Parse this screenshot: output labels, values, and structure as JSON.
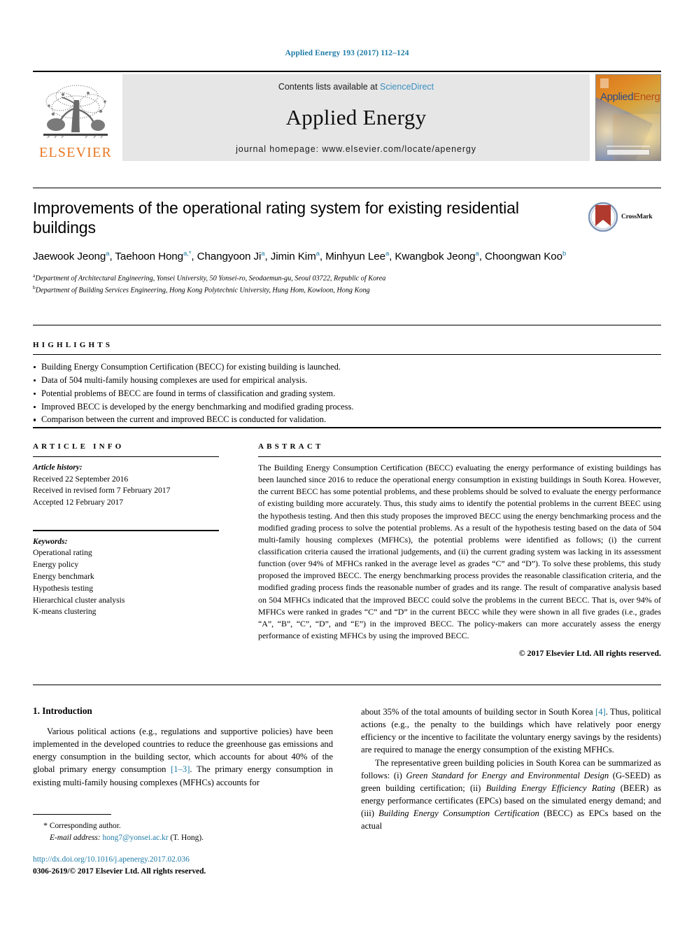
{
  "running_head": "Applied Energy 193 (2017) 112–124",
  "masthead": {
    "publisher_name": "ELSEVIER",
    "contents_prefix": "Contents lists available at ",
    "contents_link": "ScienceDirect",
    "journal_title": "Applied Energy",
    "homepage": "journal homepage: www.elsevier.com/locate/apenergy",
    "cover_title_a": "Applied",
    "cover_title_b": "Energy"
  },
  "article": {
    "title": "Improvements of the operational rating system for existing residential buildings",
    "crossmark_label": "CrossMark",
    "authors": [
      {
        "name": "Jaewook Jeong",
        "marks": "a",
        "sep": ", "
      },
      {
        "name": "Taehoon Hong",
        "marks": "a,*",
        "sep": ", "
      },
      {
        "name": "Changyoon Ji",
        "marks": "a",
        "sep": ", "
      },
      {
        "name": "Jimin Kim",
        "marks": "a",
        "sep": ", "
      },
      {
        "name": "Minhyun Lee",
        "marks": "a",
        "sep": ", "
      },
      {
        "name": "Kwangbok Jeong",
        "marks": "a",
        "sep": ", "
      },
      {
        "name": "Choongwan Koo",
        "marks": "b",
        "sep": ""
      }
    ],
    "affiliations": [
      {
        "mark": "a",
        "text": "Department of Architectural Engineering, Yonsei University, 50 Yonsei-ro, Seodaemun-gu, Seoul 03722, Republic of Korea"
      },
      {
        "mark": "b",
        "text": "Department of Building Services Engineering, Hong Kong Polytechnic University, Hung Hom, Kowloon, Hong Kong"
      }
    ]
  },
  "highlights": {
    "heading": "HIGHLIGHTS",
    "items": [
      "Building Energy Consumption Certification (BECC) for existing building is launched.",
      "Data of 504 multi-family housing complexes are used for empirical analysis.",
      "Potential problems of BECC are found in terms of classification and grading system.",
      "Improved BECC is developed by the energy benchmarking and modified grading process.",
      "Comparison between the current and improved BECC is conducted for validation."
    ]
  },
  "article_info": {
    "heading": "ARTICLE INFO",
    "history_label": "Article history:",
    "history": [
      "Received 22 September 2016",
      "Received in revised form 7 February 2017",
      "Accepted 12 February 2017"
    ],
    "keywords_label": "Keywords:",
    "keywords": [
      "Operational rating",
      "Energy policy",
      "Energy benchmark",
      "Hypothesis testing",
      "Hierarchical cluster analysis",
      "K-means clustering"
    ]
  },
  "abstract": {
    "heading": "ABSTRACT",
    "text": "The Building Energy Consumption Certification (BECC) evaluating the energy performance of existing buildings has been launched since 2016 to reduce the operational energy consumption in existing buildings in South Korea. However, the current BECC has some potential problems, and these problems should be solved to evaluate the energy performance of existing building more accurately. Thus, this study aims to identify the potential problems in the current BEEC using the hypothesis testing. And then this study proposes the improved BECC using the energy benchmarking process and the modified grading process to solve the potential problems. As a result of the hypothesis testing based on the data of 504 multi-family housing complexes (MFHCs), the potential problems were identified as follows; (i) the current classification criteria caused the irrational judgements, and (ii) the current grading system was lacking in its assessment function (over 94% of MFHCs ranked in the average level as grades “C” and “D”). To solve these problems, this study proposed the improved BECC. The energy benchmarking process provides the reasonable classification criteria, and the modified grading process finds the reasonable number of grades and its range. The result of comparative analysis based on 504 MFHCs indicated that the improved BECC could solve the problems in the current BECC. That is, over 94% of MFHCs were ranked in grades “C” and “D” in the current BECC while they were shown in all five grades (i.e., grades “A”, “B”, “C”, “D”, and “E”) in the improved BECC. The policy-makers can more accurately assess the energy performance of existing MFHCs by using the improved BECC.",
    "copyright": "© 2017 Elsevier Ltd. All rights reserved."
  },
  "body": {
    "section_title": "1. Introduction",
    "left_para_1_a": "Various political actions (e.g., regulations and supportive policies) have been implemented in the developed countries to reduce the greenhouse gas emissions and energy consumption in the building sector, which accounts for about 40% of the global primary energy consumption ",
    "left_ref_1": "[1–3]",
    "left_para_1_b": ". The primary energy consumption in existing multi-family housing complexes (MFHCs) accounts for",
    "right_para_1_a": "about 35% of the total amounts of building sector in South Korea ",
    "right_ref_1": "[4]",
    "right_para_1_b": ". Thus, political actions (e.g., the penalty to the buildings which have relatively poor energy efficiency or the incentive to facilitate the voluntary energy savings by the residents) are required to manage the energy consumption of the existing MFHCs.",
    "right_para_2_a": "The representative green building policies in South Korea can be summarized as follows: (i) ",
    "right_para_2_i1": "Green Standard for Energy and Environmental Design",
    "right_para_2_b": " (G-SEED) as green building certification; (ii) ",
    "right_para_2_i2": "Building Energy Efficiency Rating",
    "right_para_2_c": " (BEER) as energy performance certificates (EPCs) based on the simulated energy demand; and (iii) ",
    "right_para_2_i3": "Building Energy Consumption Certification",
    "right_para_2_d": " (BECC) as EPCs based on the actual"
  },
  "footer": {
    "corresponding_star": "*",
    "corresponding_label": "Corresponding author.",
    "email_label": "E-mail address:",
    "email": "hong7@yonsei.ac.kr",
    "email_suffix": "(T. Hong).",
    "doi_url": "http://dx.doi.org/10.1016/j.apenergy.2017.02.036",
    "issn_line": "0306-2619/© 2017 Elsevier Ltd. All rights reserved."
  },
  "colors": {
    "link": "#1f7ba6",
    "elsevier_orange": "#e87722",
    "banner_gray": "#e6e6e6"
  }
}
